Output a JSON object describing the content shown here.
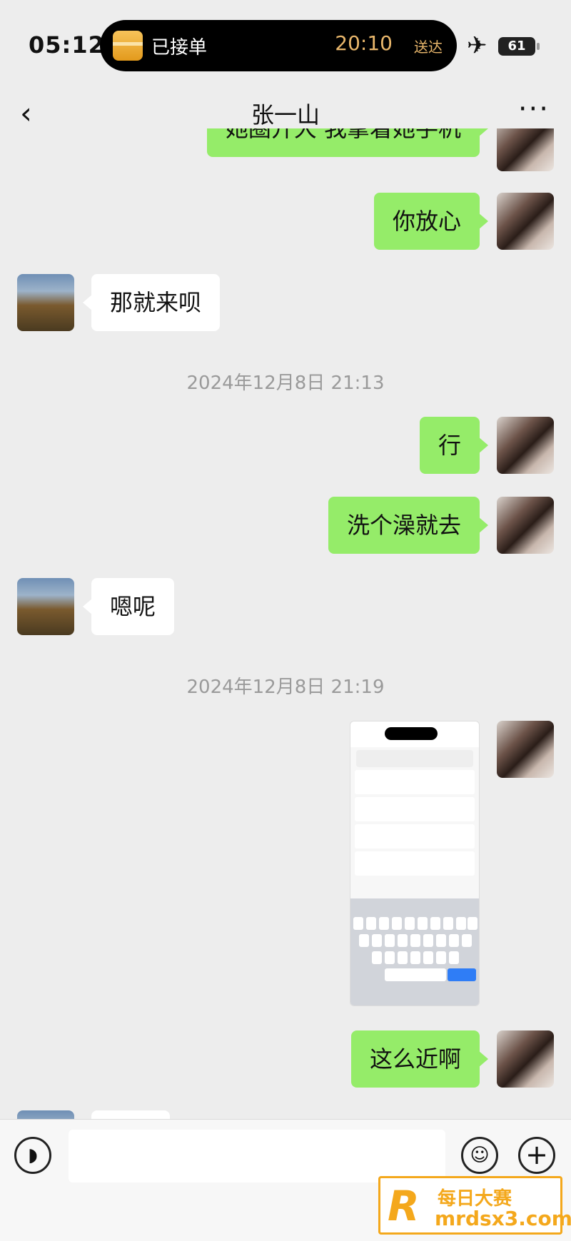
{
  "status_bar": {
    "time": "05:12",
    "live_activity": {
      "label": "已接单",
      "eta": "20:10",
      "eta_suffix": "送达"
    },
    "airplane_icon": "airplane-icon",
    "battery": "61"
  },
  "header": {
    "title": "张一山",
    "back_icon": "chevron-left-icon",
    "more_icon": "more-icon"
  },
  "messages": [
    {
      "from": "me",
      "text": "她圈开大 我拿着她手机"
    },
    {
      "from": "me",
      "text": "你放心"
    },
    {
      "from": "them",
      "text": "那就来呗"
    },
    {
      "type": "timestamp",
      "text": "2024年12月8日 21:13"
    },
    {
      "from": "me",
      "text": "行"
    },
    {
      "from": "me",
      "text": "洗个澡就去"
    },
    {
      "from": "them",
      "text": "嗯呢"
    },
    {
      "type": "timestamp",
      "text": "2024年12月8日 21:19"
    },
    {
      "from": "me",
      "type": "image",
      "description": "phone-screenshot-image"
    },
    {
      "from": "me",
      "text": "这么近啊"
    }
  ],
  "input_bar": {
    "voice_icon": "voice-icon",
    "emoji_icon": "emoji-icon",
    "plus_icon": "plus-icon",
    "text_value": ""
  },
  "watermark": {
    "logo": "R",
    "cn": "每日大赛",
    "url": "mrdsx3.com"
  },
  "colors": {
    "sent_bubble": "#95ec69",
    "received_bubble": "#ffffff",
    "background": "#ededed",
    "accent": "#f4a81c"
  }
}
